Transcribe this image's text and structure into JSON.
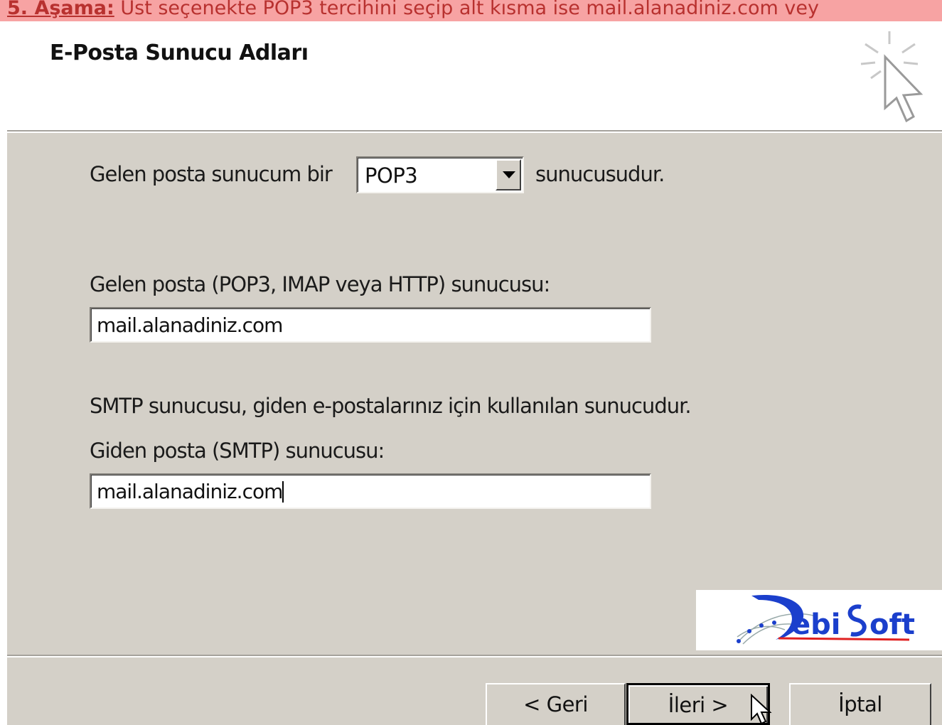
{
  "caption": {
    "step": "5. Aşama:",
    "text": " Üst seçenekte POP3 tercihini seçip alt kısma ise mail.alanadiniz.com vey"
  },
  "header": {
    "title": "E-Posta Sunucu Adları",
    "icon": "wizard-cursor-icon"
  },
  "incoming_type": {
    "label_before": "Gelen posta sunucum bir",
    "selected": "POP3",
    "label_after": "sunucusudur."
  },
  "incoming_server": {
    "label": "Gelen posta (POP3, IMAP veya HTTP) sunucusu:",
    "value": "mail.alanadiniz.com"
  },
  "smtp_info": "SMTP sunucusu, giden e-postalarınız için kullanılan sunucudur.",
  "outgoing_server": {
    "label": "Giden posta (SMTP) sunucusu:",
    "value": "mail.alanadiniz.com"
  },
  "logo": {
    "text_pre": "ebi",
    "text_post": "oft"
  },
  "buttons": {
    "back": "< Geri",
    "next": "İleri >",
    "cancel": "İptal"
  },
  "colors": {
    "caption_bg": "#f7a3a3",
    "caption_text": "#b8312f",
    "panel_bg": "#d4d0c8",
    "logo_blue": "#1b3fcc",
    "logo_red": "#e02020"
  }
}
